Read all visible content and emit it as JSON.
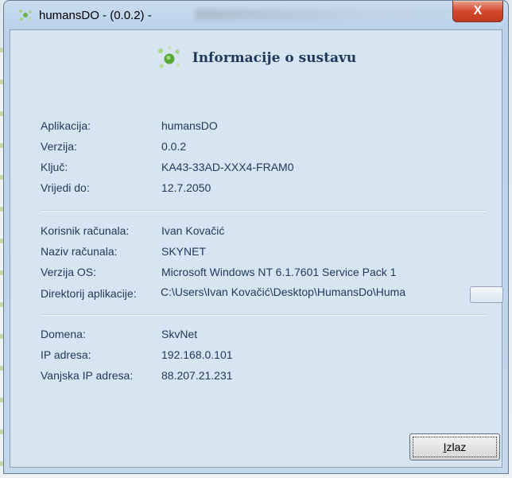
{
  "window": {
    "title": "humansDO - (0.0.2) -",
    "close_glyph": "X"
  },
  "header": {
    "title": "Informacije o sustavu"
  },
  "info": {
    "app": [
      {
        "label": "Aplikacija:",
        "value": "humansDO"
      },
      {
        "label": "Verzija:",
        "value": "0.0.2"
      },
      {
        "label": "Ključ:",
        "value": "KA43-33AD-XXX4-FRAM0"
      },
      {
        "label": "Vrijedi do:",
        "value": "12.7.2050"
      }
    ],
    "computer": [
      {
        "label": "Korisnik računala:",
        "value": "Ivan Kovačić"
      },
      {
        "label": "Naziv računala:",
        "value": "SKYNET"
      },
      {
        "label": "Verzija OS:",
        "value": "Microsoft Windows NT 6.1.7601 Service Pack 1"
      },
      {
        "label": "Direktorij aplikacije:",
        "value": "C:\\Users\\Ivan Kovačić\\Desktop\\HumansDo\\Huma"
      }
    ],
    "network": [
      {
        "label": "Domena:",
        "value": "SkvNet"
      },
      {
        "label": "IP adresa:",
        "value": "192.168.0.101"
      },
      {
        "label": "Vanjska IP adresa:",
        "value": "88.207.21.231"
      }
    ]
  },
  "buttons": {
    "exit_first": "I",
    "exit_rest": "zlaz"
  },
  "icons": {
    "app": "atom-icon",
    "close": "close-icon"
  },
  "colors": {
    "label_text": "#1e395b",
    "close_button": "#d2492f",
    "client_bg": "#d7e4f1"
  }
}
